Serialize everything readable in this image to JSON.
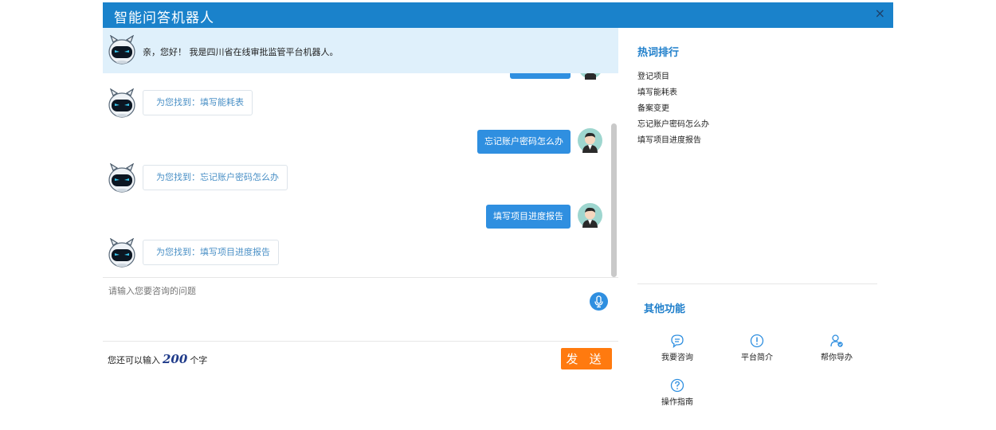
{
  "window": {
    "title": "智能问答机器人",
    "close_glyph": "×"
  },
  "greeting": {
    "text": "亲，您好！ 我是四川省在线审批监管平台机器人。"
  },
  "messages": [
    {
      "from": "bot",
      "text": "为您找到：填写能耗表"
    },
    {
      "from": "user",
      "text": "忘记账户密码怎么办"
    },
    {
      "from": "bot",
      "text": "为您找到：忘记账户密码怎么办"
    },
    {
      "from": "user",
      "text": "填写项目进度报告"
    },
    {
      "from": "bot",
      "text": "为您找到：填写项目进度报告"
    }
  ],
  "input": {
    "placeholder": "请输入您要咨询的问题",
    "value": ""
  },
  "footer": {
    "counter_prefix": "您还可以输入",
    "counter_value": "200",
    "counter_suffix": "个字",
    "send_label": "发 送"
  },
  "sidebar": {
    "hot_title": "热词排行",
    "hot_words": [
      "登记项目",
      "填写能耗表",
      "备案变更",
      "忘记账户密码怎么办",
      "填写项目进度报告"
    ],
    "other_title": "其他功能",
    "functions": [
      {
        "label": "我要咨询",
        "icon": "chat-bubble-icon"
      },
      {
        "label": "平台简介",
        "icon": "info-exclamation-icon"
      },
      {
        "label": "帮你导办",
        "icon": "user-check-icon"
      },
      {
        "label": "操作指南",
        "icon": "question-circle-icon"
      }
    ]
  },
  "colors": {
    "titlebar": "#1a82cb",
    "accent": "#1f7fcb",
    "user_bubble": "#2f8fe0",
    "send_button": "#ff7a0f",
    "greeting_bg": "#dff0fb"
  }
}
